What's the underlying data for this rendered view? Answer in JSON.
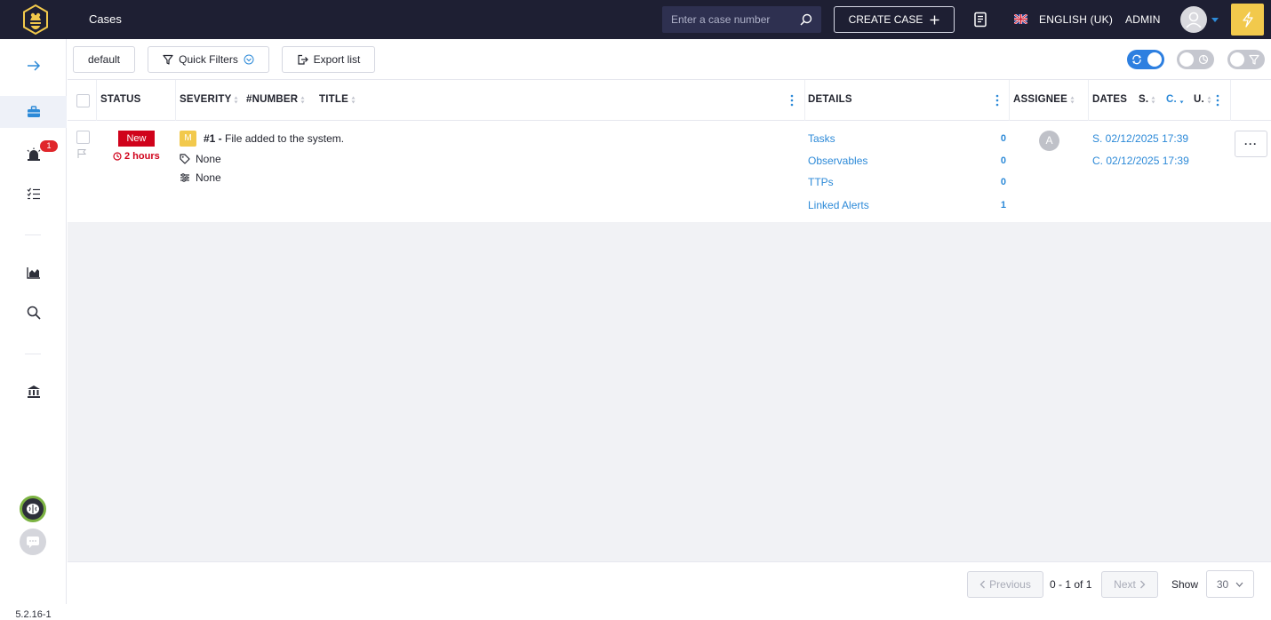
{
  "header": {
    "page_title": "Cases",
    "search_placeholder": "Enter a case number",
    "create_case_label": "CREATE CASE",
    "language": "ENGLISH (UK)",
    "user": "ADMIN"
  },
  "sidebar": {
    "alerts_badge": "1",
    "version": "5.2.16-1"
  },
  "toolbar": {
    "filter_name": "default",
    "quick_filters_label": "Quick Filters",
    "export_label": "Export list"
  },
  "table": {
    "headers": {
      "status": "STATUS",
      "severity": "SEVERITY",
      "number": "#NUMBER",
      "title": "TITLE",
      "details": "DETAILS",
      "assignee": "ASSIGNEE",
      "dates": "DATES",
      "dates_s": "S.",
      "dates_c": "C.",
      "dates_u": "U."
    },
    "rows": [
      {
        "status": "New",
        "status_age": "2 hours",
        "severity": "M",
        "number": "#1 -",
        "title": "File added to the system.",
        "tags": "None",
        "custom_fields": "None",
        "details": [
          {
            "label": "Tasks",
            "count": "0"
          },
          {
            "label": "Observables",
            "count": "0"
          },
          {
            "label": "TTPs",
            "count": "0"
          },
          {
            "label": "Linked Alerts",
            "count": "1"
          }
        ],
        "assignee_initial": "A",
        "start_date": "S. 02/12/2025 17:39",
        "created_date": "C. 02/12/2025 17:39",
        "more_label": "···"
      }
    ]
  },
  "pagination": {
    "previous_label": "Previous",
    "info": "0 - 1 of 1",
    "next_label": "Next",
    "show_label": "Show",
    "page_size": "30"
  },
  "colors": {
    "topbar": "#1e1f33",
    "accent_blue": "#2d8ad8",
    "status_red": "#d0021b",
    "severity_yellow": "#f2c94c",
    "bolt_yellow": "#f2c94c"
  },
  "icons": [
    "logo-bee-icon",
    "search-icon",
    "plus-icon",
    "book-icon",
    "uk-flag-icon",
    "user-avatar-icon",
    "caret-down-icon",
    "bolt-icon",
    "arrow-right-icon",
    "briefcase-icon",
    "alarm-icon",
    "checklist-icon",
    "chart-icon",
    "magnify-icon",
    "bank-icon",
    "brain-icon",
    "chat-icon",
    "filter-icon",
    "export-icon",
    "refresh-icon",
    "clock-icon",
    "tag-icon",
    "sliders-icon",
    "flag-outline-icon",
    "kebab-icon"
  ]
}
